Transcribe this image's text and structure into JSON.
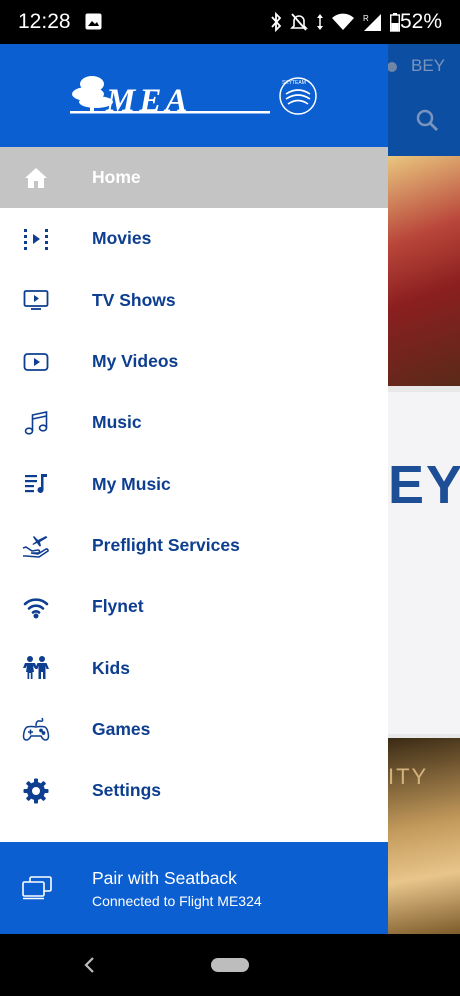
{
  "status_bar": {
    "time": "12:28",
    "battery": "52%",
    "icons": [
      "image-icon",
      "bluetooth-icon",
      "mute-icon",
      "data-arrows-icon",
      "wifi-icon",
      "signal-icon",
      "battery-icon"
    ]
  },
  "background": {
    "airport_code": "BEY",
    "card_text": "EY",
    "card2_text": "ITY"
  },
  "drawer": {
    "brand": "MEA",
    "alliance": "SKYTEAM",
    "items": [
      {
        "label": "Home",
        "icon": "home-icon",
        "active": true
      },
      {
        "label": "Movies",
        "icon": "movies-icon",
        "active": false
      },
      {
        "label": "TV Shows",
        "icon": "tv-icon",
        "active": false
      },
      {
        "label": "My Videos",
        "icon": "play-icon",
        "active": false
      },
      {
        "label": "Music",
        "icon": "music-note-icon",
        "active": false
      },
      {
        "label": "My Music",
        "icon": "playlist-icon",
        "active": false
      },
      {
        "label": "Preflight Services",
        "icon": "plane-hand-icon",
        "active": false
      },
      {
        "label": "Flynet",
        "icon": "wifi-icon",
        "active": false
      },
      {
        "label": "Kids",
        "icon": "kids-icon",
        "active": false
      },
      {
        "label": "Games",
        "icon": "gamepad-icon",
        "active": false
      },
      {
        "label": "Settings",
        "icon": "gear-icon",
        "active": false
      }
    ],
    "footer": {
      "title": "Pair with Seatback",
      "subtitle": "Connected to Flight ME324"
    }
  },
  "colors": {
    "accent": "#0b5fd1",
    "nav_text": "#0d3e8f",
    "active_row": "#c4c4c4"
  }
}
